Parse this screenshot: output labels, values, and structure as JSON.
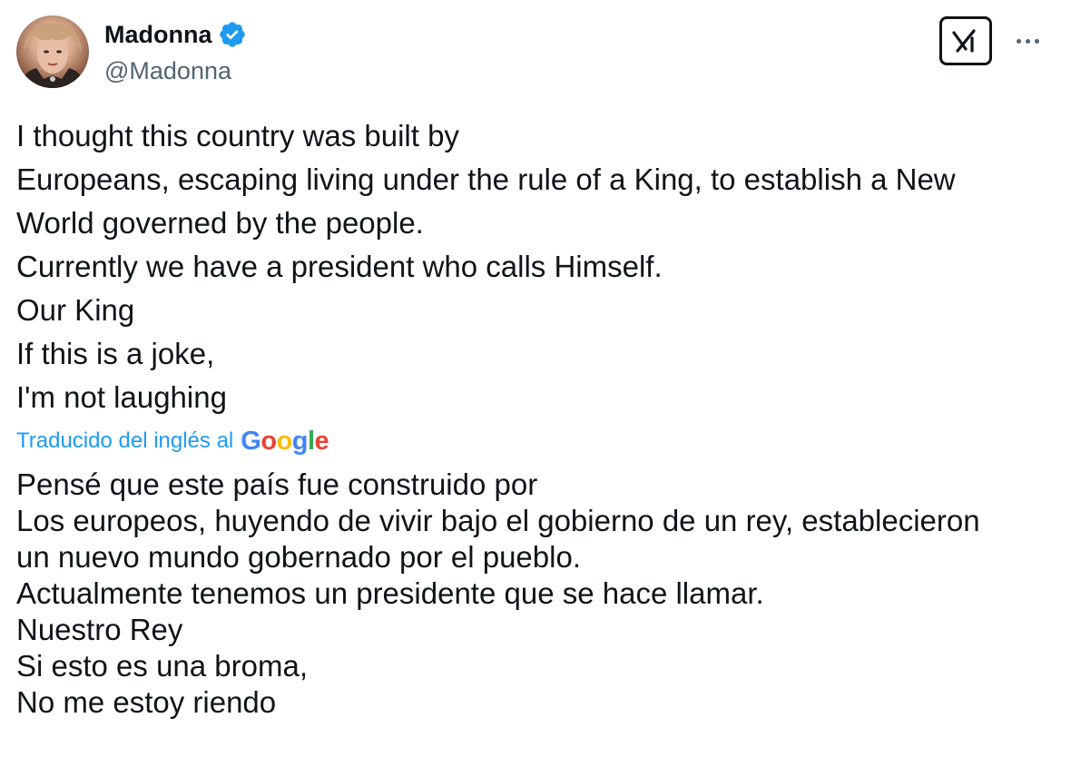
{
  "author": {
    "display_name": "Madonna",
    "handle": "@Madonna",
    "verified_icon": "verified-badge-icon",
    "avatar_icon": "profile-photo"
  },
  "actions": {
    "grok_icon": "grok-icon",
    "more_icon": "more-options-icon"
  },
  "tweet": {
    "lines": [
      "I thought this country was built by",
      "Europeans, escaping living under the rule of a King, to establish a New",
      "World governed by the people.",
      "Currently we have a president who calls Himself.",
      "Our King",
      "If this is a joke,",
      "I'm not laughing"
    ]
  },
  "translation": {
    "label": "Traducido del inglés al",
    "provider": "Google",
    "provider_colors": [
      "#4285F4",
      "#EA4335",
      "#FBBC05",
      "#4285F4",
      "#34A853",
      "#EA4335"
    ],
    "lines": [
      "Pensé que este país fue construido por",
      "Los europeos, huyendo de vivir bajo el gobierno de un rey, establecieron",
      "un nuevo mundo gobernado por el pueblo.",
      "Actualmente tenemos un presidente que se hace llamar.",
      "Nuestro Rey",
      "Si esto es una broma,",
      "No me estoy riendo"
    ]
  },
  "colors": {
    "text": "#0f1419",
    "secondary": "#536471",
    "accent": "#1d9bf0",
    "verified": "#1d9bf0"
  }
}
